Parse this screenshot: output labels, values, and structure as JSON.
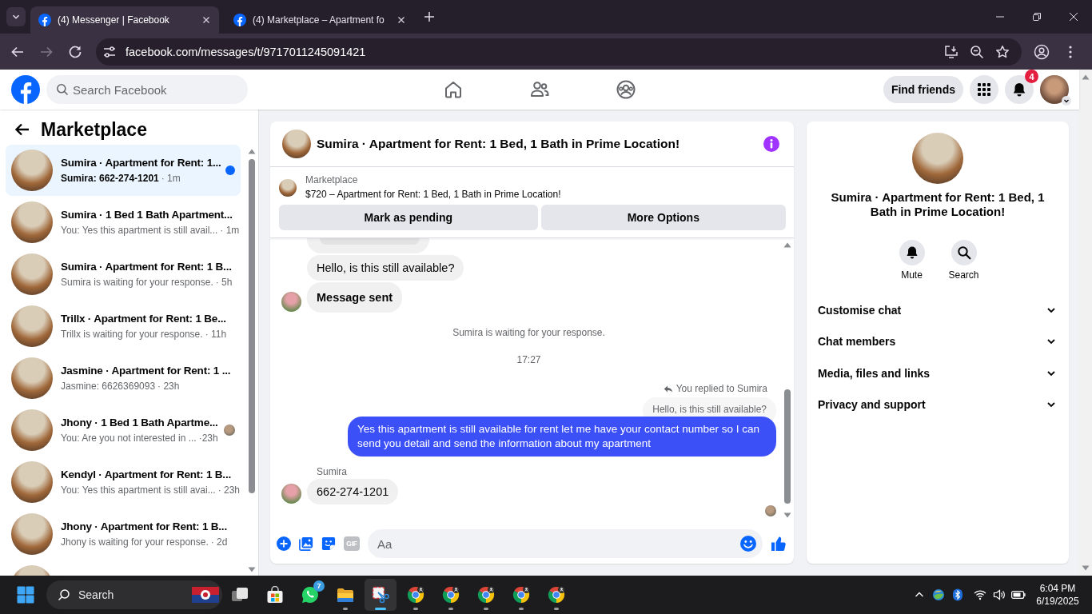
{
  "browser": {
    "tabs": [
      {
        "title": "(4) Messenger | Facebook",
        "selected": true
      },
      {
        "title": "(4) Marketplace – Apartment fo",
        "selected": false
      }
    ],
    "nav_buttons": [
      {
        "kind": "back",
        "disabled": false
      },
      {
        "kind": "forward",
        "disabled": true
      },
      {
        "kind": "reload",
        "disabled": false
      }
    ],
    "url": "facebook.com/messages/t/9717011245091421"
  },
  "topbar": {
    "search": {
      "placeholder": "Search Facebook"
    },
    "nav": [
      {
        "kind": "home",
        "selected": false
      },
      {
        "kind": "friends",
        "selected": false
      },
      {
        "kind": "groups",
        "selected": false
      }
    ],
    "find_friends": "Find friends",
    "notification_count": "4"
  },
  "sidebar": {
    "title": "Marketplace",
    "items": [
      {
        "name": "Sumira · Apartment for Rent: 1...",
        "preview": "Sumira: 662-274-1201",
        "time": "· 1m",
        "selected": true,
        "unread": true,
        "seen": false
      },
      {
        "name": "Sumira · 1 Bed 1 Bath Apartment...",
        "preview": "You: Yes this apartment is still avail...",
        "time": "· 1m",
        "selected": false,
        "unread": false,
        "seen": false
      },
      {
        "name": "Sumira · Apartment for Rent: 1 B...",
        "preview": "Sumira is waiting for your response.",
        "time": "· 5h",
        "selected": false,
        "unread": false,
        "seen": false
      },
      {
        "name": "Trillx · Apartment for Rent: 1 Be...",
        "preview": "Trillx is waiting for your response.",
        "time": "· 11h",
        "selected": false,
        "unread": false,
        "seen": false
      },
      {
        "name": "Jasmine · Apartment for Rent: 1 ...",
        "preview": "Jasmine: 6626369093",
        "time": "· 23h",
        "selected": false,
        "unread": false,
        "seen": false
      },
      {
        "name": "Jhony · 1 Bed 1 Bath Apartme...",
        "preview": "You: Are you not interested in ...",
        "time": "·23h",
        "selected": false,
        "unread": false,
        "seen": true
      },
      {
        "name": "Kendyl · Apartment for Rent: 1 B...",
        "preview": "You: Yes this apartment is still avai...",
        "time": "· 23h",
        "selected": false,
        "unread": false,
        "seen": false
      },
      {
        "name": "Jhony · Apartment for Rent: 1 B...",
        "preview": "Jhony is waiting for your response.",
        "time": "· 2d",
        "selected": false,
        "unread": false,
        "seen": false
      },
      {
        "selected": false
      }
    ]
  },
  "chat": {
    "title": "Sumira · Apartment for Rent: 1 Bed, 1 Bath in Prime Location!",
    "listing": {
      "label": "Marketplace",
      "text": "$720 – Apartment for Rent: 1 Bed, 1 Bath in Prime Location!"
    },
    "actions": [
      "Mark as pending",
      "More Options"
    ],
    "messages": [
      {
        "kind": "fragment"
      },
      {
        "kind": "incoming",
        "text": "Hello, is this still available?",
        "avatar": false,
        "bold": false
      },
      {
        "kind": "incoming",
        "text": "Message sent",
        "avatar": true,
        "bold": true
      },
      {
        "kind": "notice",
        "text": "Sumira is waiting for your response."
      },
      {
        "kind": "time",
        "text": "17:27"
      },
      {
        "kind": "reply_label",
        "text": "You replied to Sumira"
      },
      {
        "kind": "quote",
        "text": "Hello, is this still available?"
      },
      {
        "kind": "outgoing",
        "text": "Yes this apartment is still available for rent let me have your contact number so I can send you detail and send the information about my apartment"
      },
      {
        "kind": "sender",
        "text": "Sumira"
      },
      {
        "kind": "incoming",
        "text": "662-274-1201",
        "avatar": true,
        "bold": false
      },
      {
        "kind": "seen"
      }
    ],
    "composer": {
      "gif": "GIF",
      "placeholder": "Aa"
    }
  },
  "details": {
    "title": "Sumira · Apartment for Rent: 1 Bed, 1 Bath in Prime Location!",
    "actions": [
      {
        "kind": "mute",
        "label": "Mute"
      },
      {
        "kind": "search",
        "label": "Search"
      }
    ],
    "sections": [
      {
        "label": "Customise chat",
        "expanded": false
      },
      {
        "label": "Chat members",
        "expanded": false
      },
      {
        "label": "Media, files and links",
        "expanded": false
      },
      {
        "label": "Privacy and support",
        "expanded": false
      }
    ]
  },
  "taskbar": {
    "search": {
      "placeholder": "Search"
    },
    "apps": [
      {
        "kind": "task_view",
        "running": false,
        "selected": false
      },
      {
        "kind": "store",
        "running": false,
        "selected": false
      },
      {
        "kind": "whatsapp",
        "running": false,
        "selected": false,
        "badge": "7"
      },
      {
        "kind": "explorer",
        "running": true,
        "selected": false
      },
      {
        "kind": "snipping_tool",
        "running": true,
        "selected": true
      },
      {
        "kind": "chrome",
        "running": true,
        "selected": false
      },
      {
        "kind": "chrome",
        "running": true,
        "selected": false
      },
      {
        "kind": "chrome",
        "running": true,
        "selected": false
      },
      {
        "kind": "chrome",
        "running": true,
        "selected": false
      },
      {
        "kind": "chrome",
        "running": true,
        "selected": false
      }
    ],
    "time": "6:04 PM",
    "date": "6/19/2025"
  }
}
